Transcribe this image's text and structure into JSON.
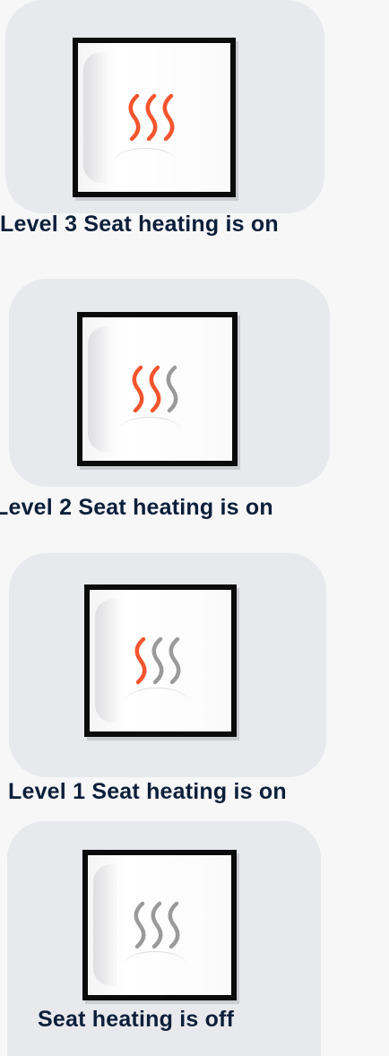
{
  "colors": {
    "wave_active": "#f4552d",
    "wave_inactive": "#9a9a9a",
    "caption_text": "#0c1f3a",
    "panel_bg": "#e8e9ed",
    "button_border": "#0b0b0b"
  },
  "states": [
    {
      "caption": "Level 3  Seat heating is on",
      "level": 3,
      "wave_icons": [
        "heat-wave-active-icon",
        "heat-wave-active-icon",
        "heat-wave-active-icon"
      ]
    },
    {
      "caption": "Level 2  Seat  heating is on",
      "level": 2,
      "wave_icons": [
        "heat-wave-active-icon",
        "heat-wave-active-icon",
        "heat-wave-inactive-icon"
      ]
    },
    {
      "caption": "Level 1  Seat heating is on",
      "level": 1,
      "wave_icons": [
        "heat-wave-active-icon",
        "heat-wave-inactive-icon",
        "heat-wave-inactive-icon"
      ]
    },
    {
      "caption": "Seat heating is off",
      "level": 0,
      "wave_icons": [
        "heat-wave-inactive-icon",
        "heat-wave-inactive-icon",
        "heat-wave-inactive-icon"
      ]
    }
  ]
}
